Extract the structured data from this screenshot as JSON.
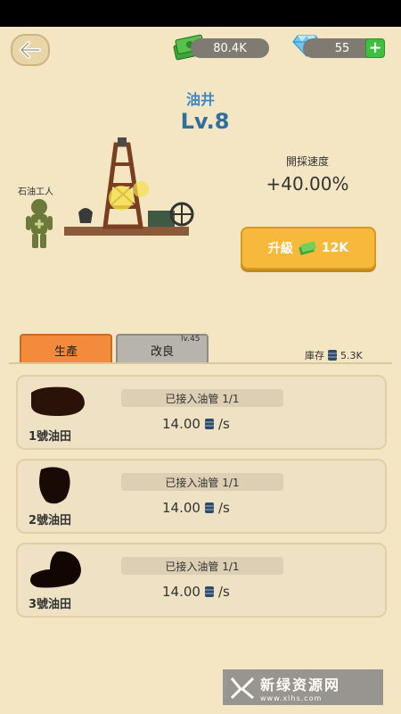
{
  "currency": {
    "cash": "80.4K",
    "gems": "55"
  },
  "building": {
    "name": "油井",
    "level": "Lv.8"
  },
  "worker": {
    "label": "石油工人"
  },
  "stats": {
    "speed_label": "開採速度",
    "speed_value": "+40.00%"
  },
  "upgrade": {
    "label": "升級",
    "cost": "12K"
  },
  "tabs": [
    {
      "label": "生產",
      "active": true
    },
    {
      "label": "改良",
      "active": false,
      "badge": "lv.45"
    }
  ],
  "stock": {
    "label": "庫存",
    "value": "5.3K"
  },
  "fields": [
    {
      "name": "1號油田",
      "pipe": "已接入油管 1/1",
      "rate": "14.00",
      "unit": "/s"
    },
    {
      "name": "2號油田",
      "pipe": "已接入油管 1/1",
      "rate": "14.00",
      "unit": "/s"
    },
    {
      "name": "3號油田",
      "pipe": "已接入油管 1/1",
      "rate": "14.00",
      "unit": "/s"
    }
  ],
  "watermark": {
    "text": "新绿资源网",
    "sub": "www.xlhs.com"
  },
  "colors": {
    "background": "#f4e6c3",
    "accent_orange": "#f28b3c",
    "upgrade_yellow": "#f6b93b",
    "title_blue": "#3b87c4"
  },
  "icons": [
    "back-arrow-icon",
    "cash-stack-icon",
    "diamond-icon",
    "plus-icon",
    "oil-barrel-icon",
    "cash-icon"
  ]
}
